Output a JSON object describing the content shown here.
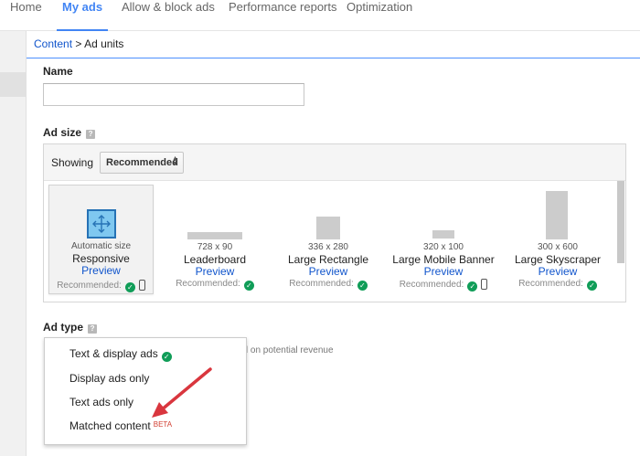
{
  "nav": {
    "tabs": [
      {
        "label": "Home"
      },
      {
        "label": "My ads"
      },
      {
        "label": "Allow & block ads"
      },
      {
        "label": "Performance reports"
      },
      {
        "label": "Optimization"
      }
    ],
    "active": "My ads"
  },
  "breadcrumb": {
    "root": "Content",
    "separator": ">",
    "current": "Ad units"
  },
  "form": {
    "name_label": "Name",
    "name_value": "",
    "ad_size_label": "Ad size",
    "help_glyph": "?",
    "showing_label": "Showing",
    "showing_value": "Recommended",
    "ad_type_label": "Ad type"
  },
  "ad_sizes": [
    {
      "dims": "Automatic size",
      "title": "Responsive",
      "preview": "Preview",
      "recommended": "Recommended:",
      "mobile": true,
      "selected": true
    },
    {
      "dims": "728 x 90",
      "title": "Leaderboard",
      "preview": "Preview",
      "recommended": "Recommended:",
      "mobile": false,
      "selected": false
    },
    {
      "dims": "336 x 280",
      "title": "Large Rectangle",
      "preview": "Preview",
      "recommended": "Recommended:",
      "mobile": false,
      "selected": false
    },
    {
      "dims": "320 x 100",
      "title": "Large Mobile Banner",
      "preview": "Preview",
      "recommended": "Recommended:",
      "mobile": true,
      "selected": false
    },
    {
      "dims": "300 x 600",
      "title": "Large Skyscraper",
      "preview": "Preview",
      "recommended": "Recommended:",
      "mobile": false,
      "selected": false
    }
  ],
  "ad_type": {
    "options": [
      {
        "label": "Text & display ads",
        "recommended": true
      },
      {
        "label": "Display ads only",
        "recommended": false
      },
      {
        "label": "Text ads only",
        "recommended": false
      },
      {
        "label": "Matched content",
        "badge": "BETA",
        "recommended": false
      }
    ],
    "partial_note": "ed on potential revenue"
  },
  "colors": {
    "accent": "#4285f4",
    "link": "#1155cc",
    "check": "#109d58",
    "annotation_arrow": "#d9363e"
  },
  "icons": {
    "help": "help-icon",
    "check": "check-icon",
    "mobile": "phone-icon",
    "resize": "resize-arrows-icon",
    "dropdown": "up-down-arrows-icon"
  }
}
